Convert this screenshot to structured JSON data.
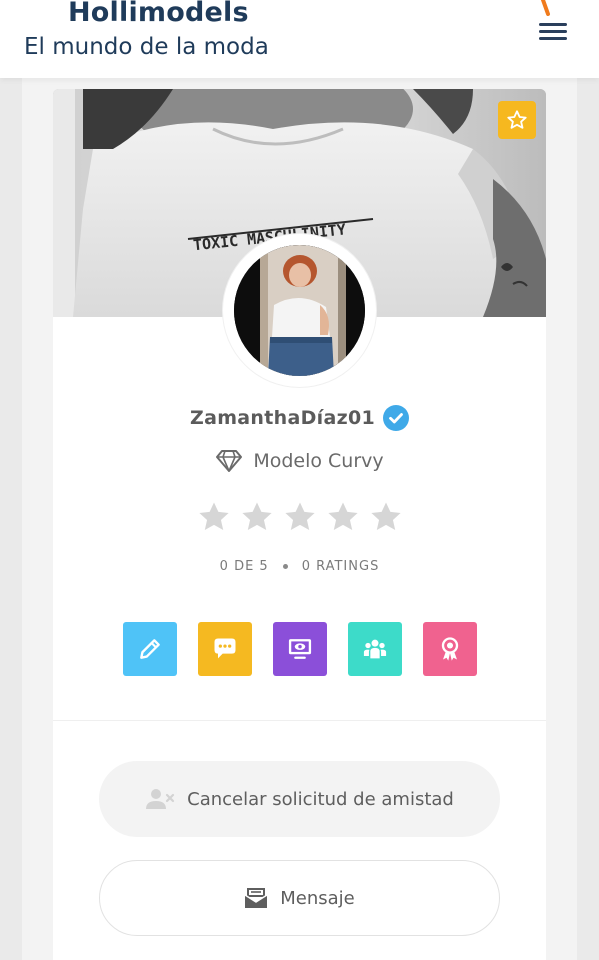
{
  "header": {
    "title": "Hollimodels",
    "subtitle": "El mundo de la moda",
    "menu_icon": "hamburger-menu-icon"
  },
  "profile": {
    "username": "ZamanthaDíaz01",
    "verified_icon": "verified-check-icon",
    "role": "Modelo Curvy",
    "role_icon": "diamond-icon",
    "rating_value": 0,
    "rating_max": 5,
    "rating_text": "0 DE 5",
    "ratings_count_text": "0 RATINGS"
  },
  "actions": [
    {
      "icon": "pencil-icon",
      "color": "#4fc3f7"
    },
    {
      "icon": "chat-bubble-icon",
      "color": "#f5b921"
    },
    {
      "icon": "screen-icon",
      "color": "#8b4fd9"
    },
    {
      "icon": "group-icon",
      "color": "#3ddbc9"
    },
    {
      "icon": "award-ribbon-icon",
      "color": "#f0628f"
    }
  ],
  "buttons": {
    "cancel_friend_request": "Cancelar solicitud de amistad",
    "message": "Mensaje"
  },
  "colors": {
    "brand": "#1f3b5a",
    "favorite": "#f6b81f",
    "verified": "#3fa9e8",
    "star_empty": "#d6d6d6"
  }
}
